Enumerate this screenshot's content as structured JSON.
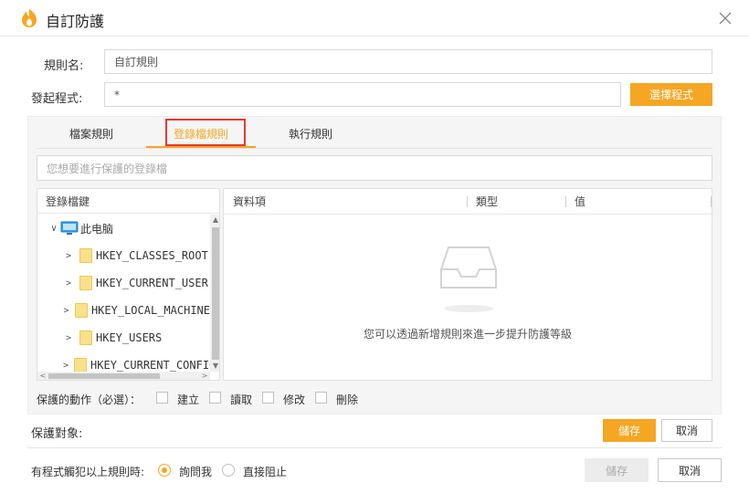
{
  "window": {
    "title": "自訂防護"
  },
  "form": {
    "rule_name_label": "規則名:",
    "rule_name_value": "自訂規則",
    "program_label": "發起程式:",
    "program_value": "*",
    "select_program_button": "選擇程式"
  },
  "tabs": [
    {
      "label": "檔案規則",
      "active": false
    },
    {
      "label": "登錄檔規則",
      "active": true
    },
    {
      "label": "執行規則",
      "active": false
    }
  ],
  "registry": {
    "search_placeholder": "您想要進行保護的登錄檔",
    "tree_header": "登錄檔鍵",
    "root": "此电脑",
    "keys": [
      "HKEY_CLASSES_ROOT",
      "HKEY_CURRENT_USER",
      "HKEY_LOCAL_MACHINE",
      "HKEY_USERS",
      "HKEY_CURRENT_CONFIG"
    ],
    "columns": [
      "資料項",
      "類型",
      "值"
    ],
    "empty_message": "您可以透過新增規則來進一步提升防護等級"
  },
  "actions": {
    "label": "保護的動作（必選）：",
    "options": [
      "建立",
      "讀取",
      "修改",
      "刪除"
    ]
  },
  "target": {
    "label": "保護對象:",
    "save": "儲存",
    "cancel": "取消"
  },
  "violation": {
    "label": "有程式觸犯以上規則時:",
    "options": [
      {
        "label": "詢問我",
        "selected": true
      },
      {
        "label": "直接阻止",
        "selected": false
      }
    ]
  },
  "footer": {
    "save": "儲存",
    "cancel": "取消"
  },
  "colors": {
    "accent": "#f5a623",
    "highlight_box": "#e53935"
  }
}
